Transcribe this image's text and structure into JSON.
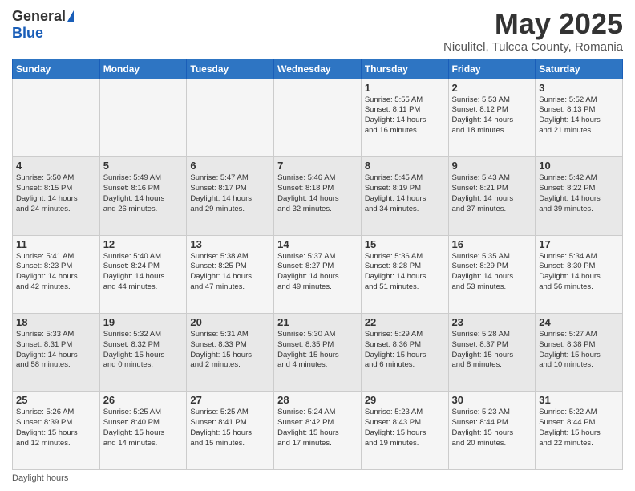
{
  "logo": {
    "general": "General",
    "blue": "Blue"
  },
  "header": {
    "title": "May 2025",
    "subtitle": "Niculitel, Tulcea County, Romania"
  },
  "weekdays": [
    "Sunday",
    "Monday",
    "Tuesday",
    "Wednesday",
    "Thursday",
    "Friday",
    "Saturday"
  ],
  "footer": {
    "note": "Daylight hours"
  },
  "weeks": [
    [
      {
        "day": "",
        "info": ""
      },
      {
        "day": "",
        "info": ""
      },
      {
        "day": "",
        "info": ""
      },
      {
        "day": "",
        "info": ""
      },
      {
        "day": "1",
        "info": "Sunrise: 5:55 AM\nSunset: 8:11 PM\nDaylight: 14 hours\nand 16 minutes."
      },
      {
        "day": "2",
        "info": "Sunrise: 5:53 AM\nSunset: 8:12 PM\nDaylight: 14 hours\nand 18 minutes."
      },
      {
        "day": "3",
        "info": "Sunrise: 5:52 AM\nSunset: 8:13 PM\nDaylight: 14 hours\nand 21 minutes."
      }
    ],
    [
      {
        "day": "4",
        "info": "Sunrise: 5:50 AM\nSunset: 8:15 PM\nDaylight: 14 hours\nand 24 minutes."
      },
      {
        "day": "5",
        "info": "Sunrise: 5:49 AM\nSunset: 8:16 PM\nDaylight: 14 hours\nand 26 minutes."
      },
      {
        "day": "6",
        "info": "Sunrise: 5:47 AM\nSunset: 8:17 PM\nDaylight: 14 hours\nand 29 minutes."
      },
      {
        "day": "7",
        "info": "Sunrise: 5:46 AM\nSunset: 8:18 PM\nDaylight: 14 hours\nand 32 minutes."
      },
      {
        "day": "8",
        "info": "Sunrise: 5:45 AM\nSunset: 8:19 PM\nDaylight: 14 hours\nand 34 minutes."
      },
      {
        "day": "9",
        "info": "Sunrise: 5:43 AM\nSunset: 8:21 PM\nDaylight: 14 hours\nand 37 minutes."
      },
      {
        "day": "10",
        "info": "Sunrise: 5:42 AM\nSunset: 8:22 PM\nDaylight: 14 hours\nand 39 minutes."
      }
    ],
    [
      {
        "day": "11",
        "info": "Sunrise: 5:41 AM\nSunset: 8:23 PM\nDaylight: 14 hours\nand 42 minutes."
      },
      {
        "day": "12",
        "info": "Sunrise: 5:40 AM\nSunset: 8:24 PM\nDaylight: 14 hours\nand 44 minutes."
      },
      {
        "day": "13",
        "info": "Sunrise: 5:38 AM\nSunset: 8:25 PM\nDaylight: 14 hours\nand 47 minutes."
      },
      {
        "day": "14",
        "info": "Sunrise: 5:37 AM\nSunset: 8:27 PM\nDaylight: 14 hours\nand 49 minutes."
      },
      {
        "day": "15",
        "info": "Sunrise: 5:36 AM\nSunset: 8:28 PM\nDaylight: 14 hours\nand 51 minutes."
      },
      {
        "day": "16",
        "info": "Sunrise: 5:35 AM\nSunset: 8:29 PM\nDaylight: 14 hours\nand 53 minutes."
      },
      {
        "day": "17",
        "info": "Sunrise: 5:34 AM\nSunset: 8:30 PM\nDaylight: 14 hours\nand 56 minutes."
      }
    ],
    [
      {
        "day": "18",
        "info": "Sunrise: 5:33 AM\nSunset: 8:31 PM\nDaylight: 14 hours\nand 58 minutes."
      },
      {
        "day": "19",
        "info": "Sunrise: 5:32 AM\nSunset: 8:32 PM\nDaylight: 15 hours\nand 0 minutes."
      },
      {
        "day": "20",
        "info": "Sunrise: 5:31 AM\nSunset: 8:33 PM\nDaylight: 15 hours\nand 2 minutes."
      },
      {
        "day": "21",
        "info": "Sunrise: 5:30 AM\nSunset: 8:35 PM\nDaylight: 15 hours\nand 4 minutes."
      },
      {
        "day": "22",
        "info": "Sunrise: 5:29 AM\nSunset: 8:36 PM\nDaylight: 15 hours\nand 6 minutes."
      },
      {
        "day": "23",
        "info": "Sunrise: 5:28 AM\nSunset: 8:37 PM\nDaylight: 15 hours\nand 8 minutes."
      },
      {
        "day": "24",
        "info": "Sunrise: 5:27 AM\nSunset: 8:38 PM\nDaylight: 15 hours\nand 10 minutes."
      }
    ],
    [
      {
        "day": "25",
        "info": "Sunrise: 5:26 AM\nSunset: 8:39 PM\nDaylight: 15 hours\nand 12 minutes."
      },
      {
        "day": "26",
        "info": "Sunrise: 5:25 AM\nSunset: 8:40 PM\nDaylight: 15 hours\nand 14 minutes."
      },
      {
        "day": "27",
        "info": "Sunrise: 5:25 AM\nSunset: 8:41 PM\nDaylight: 15 hours\nand 15 minutes."
      },
      {
        "day": "28",
        "info": "Sunrise: 5:24 AM\nSunset: 8:42 PM\nDaylight: 15 hours\nand 17 minutes."
      },
      {
        "day": "29",
        "info": "Sunrise: 5:23 AM\nSunset: 8:43 PM\nDaylight: 15 hours\nand 19 minutes."
      },
      {
        "day": "30",
        "info": "Sunrise: 5:23 AM\nSunset: 8:44 PM\nDaylight: 15 hours\nand 20 minutes."
      },
      {
        "day": "31",
        "info": "Sunrise: 5:22 AM\nSunset: 8:44 PM\nDaylight: 15 hours\nand 22 minutes."
      }
    ]
  ]
}
